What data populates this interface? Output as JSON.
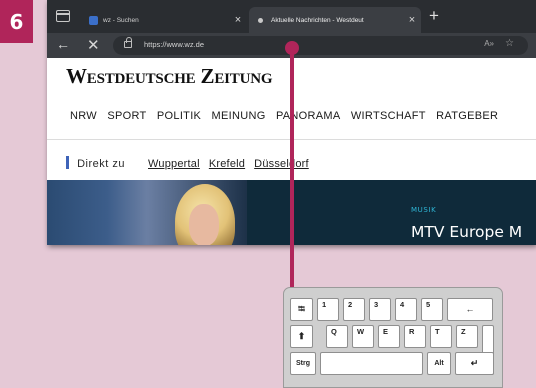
{
  "step_number": "6",
  "browser": {
    "tabs": [
      {
        "title": "wz - Suchen",
        "active": false,
        "close": "×"
      },
      {
        "title": "Aktuelle Nachrichten - Westdeut",
        "active": true,
        "close": "×"
      }
    ],
    "new_tab_label": "+",
    "back_label": "←",
    "stop_label": "✕",
    "url": "https://www.wz.de",
    "read_aloud_label": "A»",
    "favorite_label": "☆"
  },
  "website": {
    "logo": "Westdeutsche Zeitung",
    "nav": [
      "NRW",
      "SPORT",
      "POLITIK",
      "MEINUNG",
      "PANORAMA",
      "WIRTSCHAFT",
      "RATGEBER"
    ],
    "quicklinks_label": "Direkt zu",
    "quicklinks": [
      "Wuppertal",
      "Krefeld",
      "Düsseldorf"
    ],
    "hero_category": "MUSIK",
    "hero_headline": "MTV Europe M"
  },
  "keyboard": {
    "tab_key": "⭾",
    "digit_keys": [
      "1",
      "2",
      "3",
      "4",
      "5"
    ],
    "backspace_key": "←",
    "shift_key": "⬆",
    "letter_keys": [
      "Q",
      "W",
      "E",
      "R",
      "T",
      "Z"
    ],
    "ctrl_key": "Strg",
    "alt_key": "Alt",
    "enter_key": "↵"
  },
  "colors": {
    "accent": "#b0255a",
    "background": "#e5c9d6",
    "tab_bar": "#2a2d31",
    "address_bar": "#3b3e43",
    "quicklink_marker": "#3e63b8",
    "hero_category": "#2fb6d6"
  }
}
